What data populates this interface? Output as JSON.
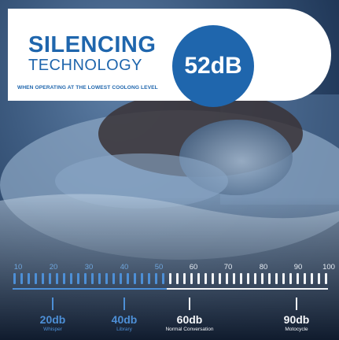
{
  "banner": {
    "title_line1": "SILENCING",
    "title_line2": "TECHNOLOGY",
    "subtitle": "WHEN OPERATING AT THE LOWEST COOLONG LEVEL",
    "badge_value": "52dB"
  },
  "scale": {
    "labels": [
      "10",
      "20",
      "30",
      "40",
      "50",
      "60",
      "70",
      "80",
      "90",
      "100"
    ],
    "markers": [
      {
        "value": "20db",
        "desc": "Whisper"
      },
      {
        "value": "40db",
        "desc": "Library"
      },
      {
        "value": "60db",
        "desc": "Normal Conversation"
      },
      {
        "value": "90db",
        "desc": "Motocycle"
      }
    ]
  },
  "colors": {
    "brand_blue": "#1f66ad",
    "scale_blue": "#4d8fd6",
    "scale_white": "#f2f4f7"
  }
}
